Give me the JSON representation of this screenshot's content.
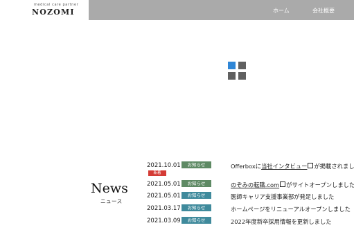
{
  "header": {
    "logo_sub": "medical care partner",
    "logo_main": "NOZOMI",
    "nav": [
      {
        "label": "ホーム"
      },
      {
        "label": "会社概要"
      }
    ]
  },
  "news": {
    "title": "News",
    "subtitle": "ニュース",
    "new_label": "新着",
    "items": [
      {
        "date": "2021.10.01",
        "category": "お知らせ",
        "pre": "Offerboxに",
        "link": "当社インタビュー",
        "post": "が掲載されました"
      },
      {
        "date": "2021.05.01",
        "category": "お知らせ",
        "pre": "",
        "link": "のぞみの転職.com",
        "post": "がサイトオープンしました"
      },
      {
        "date": "2021.05.01",
        "category": "お知らせ",
        "pre": "医師キャリア支援事業部が発足しました",
        "link": "",
        "post": ""
      },
      {
        "date": "2021.03.17",
        "category": "お知らせ",
        "pre": "ホームページをリニューアルオープンしました",
        "link": "",
        "post": ""
      },
      {
        "date": "2021.03.09",
        "category": "お知らせ",
        "pre": "2022年度新卒採用情報を更新しました",
        "link": "",
        "post": ""
      }
    ]
  },
  "colors": {
    "nav_bg": "#aaaaaa",
    "accent_blue": "#2f86d6",
    "badge_green": "#5e8a64",
    "badge_teal": "#3f8a9c",
    "new_red": "#d43b35"
  },
  "icons": [
    "logo-grid-icon",
    "external-link-icon"
  ]
}
